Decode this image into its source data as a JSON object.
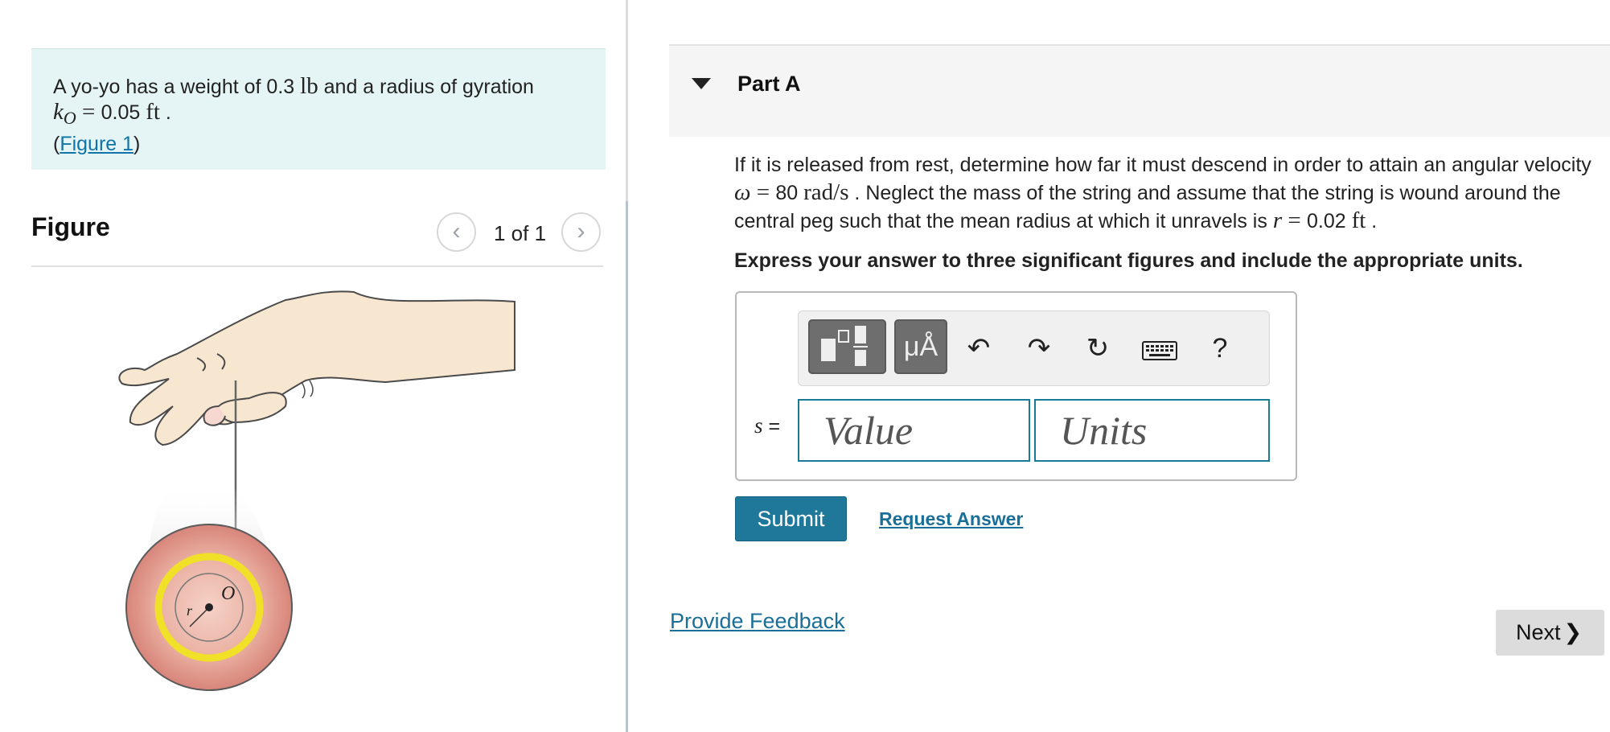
{
  "problem": {
    "text_line1_prefix": "A yo-yo has a weight of 0.3 ",
    "weight_unit": "lb",
    "text_line1_suffix": " and a radius of gyration",
    "k_symbol": "k",
    "k_sub": "O",
    "k_equals": " = ",
    "k_value": "0.05",
    "k_unit": "ft",
    "period": " .",
    "open_paren": "(",
    "figure_link": "Figure 1",
    "close_paren": ")"
  },
  "figure": {
    "title": "Figure",
    "counter": "1 of 1",
    "prev_glyph": "‹",
    "next_glyph": "›",
    "label_r": "r",
    "label_O": "O"
  },
  "part": {
    "title": "Part A"
  },
  "question": {
    "t1": "If it is released from rest, determine how far it must descend in order to attain an angular velocity ",
    "omega": "ω",
    "eq": " = ",
    "omega_value": "80",
    "omega_unit": "rad/s",
    "t2": " . Neglect the mass of the string and assume that the string is wound around the central peg such that the mean radius at which it unravels is ",
    "r_symbol": "r",
    "r_value": "0.02",
    "r_unit": "ft",
    "t3": " ."
  },
  "instruction": "Express your answer to three significant figures and include the appropriate units.",
  "toolbar": {
    "units_label": "μÅ",
    "undo_glyph": "↶",
    "redo_glyph": "↷",
    "reset_glyph": "↻",
    "help_label": "?"
  },
  "answer": {
    "variable": "s",
    "equals": " =",
    "value_placeholder": "Value",
    "units_placeholder": "Units"
  },
  "buttons": {
    "submit": "Submit",
    "request_answer": "Request Answer",
    "provide_feedback": "Provide Feedback",
    "next": "Next",
    "next_chevron": "❯"
  }
}
